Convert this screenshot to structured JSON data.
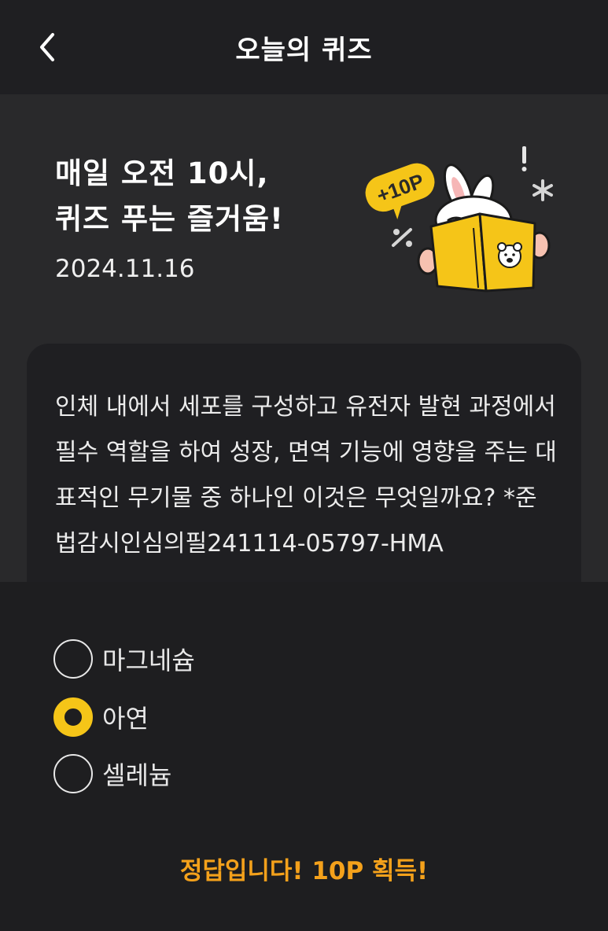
{
  "header": {
    "title": "오늘의 퀴즈",
    "back_icon": "chevron-left-icon"
  },
  "hero": {
    "headline_line1": "매일 오전 10시,",
    "headline_line2": "퀴즈 푸는 즐거움!",
    "date": "2024.11.16",
    "badge": "+10P",
    "accent_color": "#f5c518"
  },
  "question": {
    "text": "인체 내에서 세포를 구성하고 유전자 발현 과정에서 필수 역할을 하여 성장, 면역 기능에 영향을 주는 대표적인 무기물 중 하나인 이것은 무엇일까요? *준법감시인심의필241114-05797-HMA"
  },
  "options": [
    {
      "label": "마그네슘",
      "selected": false
    },
    {
      "label": "아연",
      "selected": true
    },
    {
      "label": "셀레늄",
      "selected": false
    }
  ],
  "result": {
    "text": "정답입니다! 10P 획득!",
    "color": "#f4a11b"
  }
}
